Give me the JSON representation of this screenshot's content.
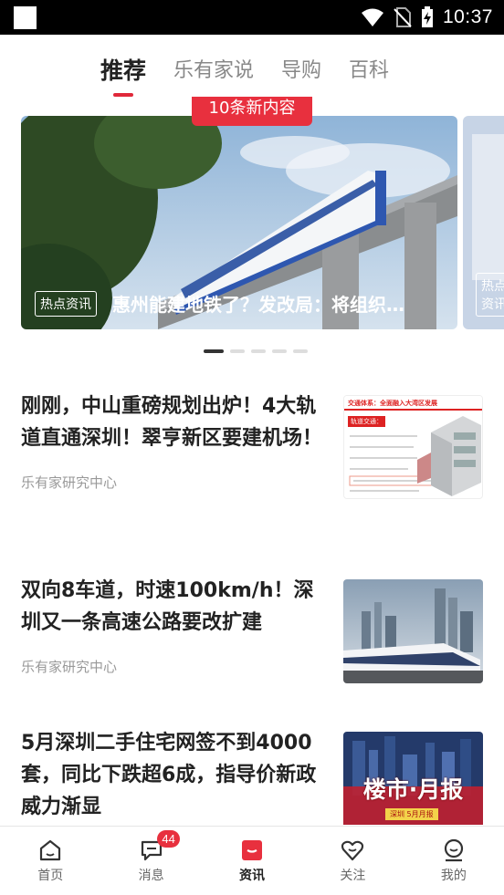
{
  "status_bar": {
    "time": "10:37"
  },
  "tabs": [
    {
      "label": "推荐",
      "active": true
    },
    {
      "label": "乐有家说"
    },
    {
      "label": "导购"
    },
    {
      "label": "百科"
    }
  ],
  "carousel": {
    "new_badge": "10条新内容",
    "slides": [
      {
        "tag": "热点资讯",
        "caption": "惠州能建地铁了？发改局：将组织…"
      },
      {
        "tag": "热点资讯",
        "caption": ""
      }
    ],
    "page_count": 5,
    "current_page": 1
  },
  "news": [
    {
      "title": "刚刚，中山重磅规划出炉！4大轨道直通深圳！翠亨新区要建机场！",
      "source": "乐有家研究中心",
      "thumb": {
        "heading": "交通体系：全面融入大湾区发展",
        "sub": "轨道交通："
      }
    },
    {
      "title": "双向8车道，时速100km/h！深圳又一条高速公路要改扩建",
      "source": "乐有家研究中心"
    },
    {
      "title": "5月深圳二手住宅网签不到4000套，同比下跌超6成，指导价新政威力渐显",
      "source": "",
      "thumb": {
        "heading": "楼市·月报",
        "sub": "深圳 5月月报"
      }
    }
  ],
  "bottom_nav": [
    {
      "label": "首页",
      "icon": "home-icon"
    },
    {
      "label": "消息",
      "icon": "message-icon",
      "badge": "44"
    },
    {
      "label": "资讯",
      "icon": "news-icon",
      "active": true
    },
    {
      "label": "关注",
      "icon": "heart-icon"
    },
    {
      "label": "我的",
      "icon": "profile-icon"
    }
  ],
  "colors": {
    "accent": "#e8303e",
    "text": "#222222",
    "muted": "#999999"
  }
}
